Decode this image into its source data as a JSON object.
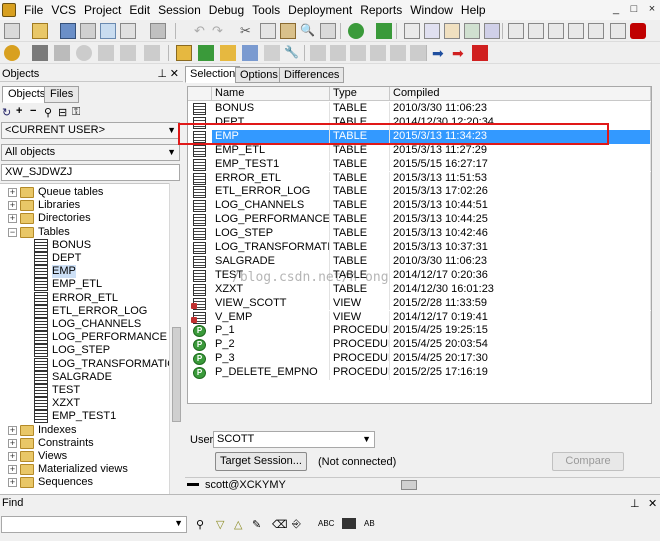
{
  "menubar": {
    "items": [
      "File",
      "VCS",
      "Project",
      "Edit",
      "Session",
      "Debug",
      "Tools",
      "Deployment",
      "Reports",
      "Window",
      "Help"
    ],
    "window_controls": [
      "_",
      "□",
      "×"
    ]
  },
  "objects_panel": {
    "title": "Objects",
    "tabs": [
      "Objects",
      "Files"
    ],
    "user_filter": "<CURRENT USER>",
    "object_filter": "All objects",
    "connection_input": "XW_SJDWZJ",
    "tree": [
      {
        "label": "Queue tables",
        "kind": "folder",
        "expanded": false,
        "level": 0
      },
      {
        "label": "Libraries",
        "kind": "folder",
        "expanded": false,
        "level": 0
      },
      {
        "label": "Directories",
        "kind": "folder",
        "expanded": false,
        "level": 0
      },
      {
        "label": "Tables",
        "kind": "folder",
        "expanded": true,
        "level": 0
      },
      {
        "label": "BONUS",
        "kind": "table",
        "level": 1
      },
      {
        "label": "DEPT",
        "kind": "table",
        "level": 1
      },
      {
        "label": "EMP",
        "kind": "table",
        "level": 1,
        "selected": true
      },
      {
        "label": "EMP_ETL",
        "kind": "table",
        "level": 1
      },
      {
        "label": "ERROR_ETL",
        "kind": "table",
        "level": 1
      },
      {
        "label": "ETL_ERROR_LOG",
        "kind": "table",
        "level": 1
      },
      {
        "label": "LOG_CHANNELS",
        "kind": "table",
        "level": 1
      },
      {
        "label": "LOG_PERFORMANCE",
        "kind": "table",
        "level": 1
      },
      {
        "label": "LOG_STEP",
        "kind": "table",
        "level": 1
      },
      {
        "label": "LOG_TRANSFORMATION",
        "kind": "table",
        "level": 1
      },
      {
        "label": "SALGRADE",
        "kind": "table",
        "level": 1
      },
      {
        "label": "TEST",
        "kind": "table",
        "level": 1
      },
      {
        "label": "XZXT",
        "kind": "table",
        "level": 1
      },
      {
        "label": "EMP_TEST1",
        "kind": "table",
        "level": 1
      },
      {
        "label": "Indexes",
        "kind": "folder",
        "expanded": false,
        "level": 0
      },
      {
        "label": "Constraints",
        "kind": "folder",
        "expanded": false,
        "level": 0
      },
      {
        "label": "Views",
        "kind": "folder",
        "expanded": false,
        "level": 0
      },
      {
        "label": "Materialized views",
        "kind": "folder",
        "expanded": false,
        "level": 0
      },
      {
        "label": "Sequences",
        "kind": "folder",
        "expanded": false,
        "level": 0
      }
    ]
  },
  "find_panel": {
    "title": "Find",
    "option_labels": [
      "ABC",
      "AB"
    ]
  },
  "main": {
    "tabs": [
      "Selection",
      "Options",
      "Differences"
    ],
    "columns": [
      "Name",
      "Type",
      "Compiled"
    ],
    "rows": [
      {
        "name": "BONUS",
        "type": "TABLE",
        "compiled": "2010/3/30 11:06:23",
        "icon": "table"
      },
      {
        "name": "DEPT",
        "type": "TABLE",
        "compiled": "2014/12/30 12:20:34",
        "icon": "table"
      },
      {
        "name": "EMP",
        "type": "TABLE",
        "compiled": "2015/3/13 11:34:23",
        "icon": "table",
        "selected": true
      },
      {
        "name": "EMP_ETL",
        "type": "TABLE",
        "compiled": "2015/3/13 11:27:29",
        "icon": "table"
      },
      {
        "name": "EMP_TEST1",
        "type": "TABLE",
        "compiled": "2015/5/15 16:27:17",
        "icon": "table"
      },
      {
        "name": "ERROR_ETL",
        "type": "TABLE",
        "compiled": "2015/3/13 11:51:53",
        "icon": "table"
      },
      {
        "name": "ETL_ERROR_LOG",
        "type": "TABLE",
        "compiled": "2015/3/13 17:02:26",
        "icon": "table"
      },
      {
        "name": "LOG_CHANNELS",
        "type": "TABLE",
        "compiled": "2015/3/13 10:44:51",
        "icon": "table"
      },
      {
        "name": "LOG_PERFORMANCE",
        "type": "TABLE",
        "compiled": "2015/3/13 10:44:25",
        "icon": "table"
      },
      {
        "name": "LOG_STEP",
        "type": "TABLE",
        "compiled": "2015/3/13 10:42:46",
        "icon": "table"
      },
      {
        "name": "LOG_TRANSFORMATION",
        "type": "TABLE",
        "compiled": "2015/3/13 10:37:31",
        "icon": "table"
      },
      {
        "name": "SALGRADE",
        "type": "TABLE",
        "compiled": "2010/3/30 11:06:23",
        "icon": "table"
      },
      {
        "name": "TEST",
        "type": "TABLE",
        "compiled": "2014/12/17 0:20:36",
        "icon": "table"
      },
      {
        "name": "XZXT",
        "type": "TABLE",
        "compiled": "2014/12/30 16:01:23",
        "icon": "table"
      },
      {
        "name": "VIEW_SCOTT",
        "type": "VIEW",
        "compiled": "2015/2/28 11:33:59",
        "icon": "view"
      },
      {
        "name": "V_EMP",
        "type": "VIEW",
        "compiled": "2014/12/17 0:19:41",
        "icon": "view"
      },
      {
        "name": "P_1",
        "type": "PROCEDURE",
        "compiled": "2015/4/25 19:25:15",
        "icon": "proc"
      },
      {
        "name": "P_2",
        "type": "PROCEDURE",
        "compiled": "2015/4/25 20:03:54",
        "icon": "proc"
      },
      {
        "name": "P_3",
        "type": "PROCEDURE",
        "compiled": "2015/4/25 20:17:30",
        "icon": "proc"
      },
      {
        "name": "P_DELETE_EMPNO",
        "type": "PROCEDURE",
        "compiled": "2015/2/25 17:16:19",
        "icon": "proc"
      }
    ],
    "watermark": "/blog.csdn.net/h        ong",
    "user_label": "User",
    "user_value": "SCOTT",
    "target_session_button": "Target Session...",
    "connection_status": "(Not connected)",
    "compare_button": "Compare",
    "status_connection": "scott@XCKYMY"
  },
  "colors": {
    "selection": "#3399ff",
    "highlight_box": "#e01818"
  }
}
